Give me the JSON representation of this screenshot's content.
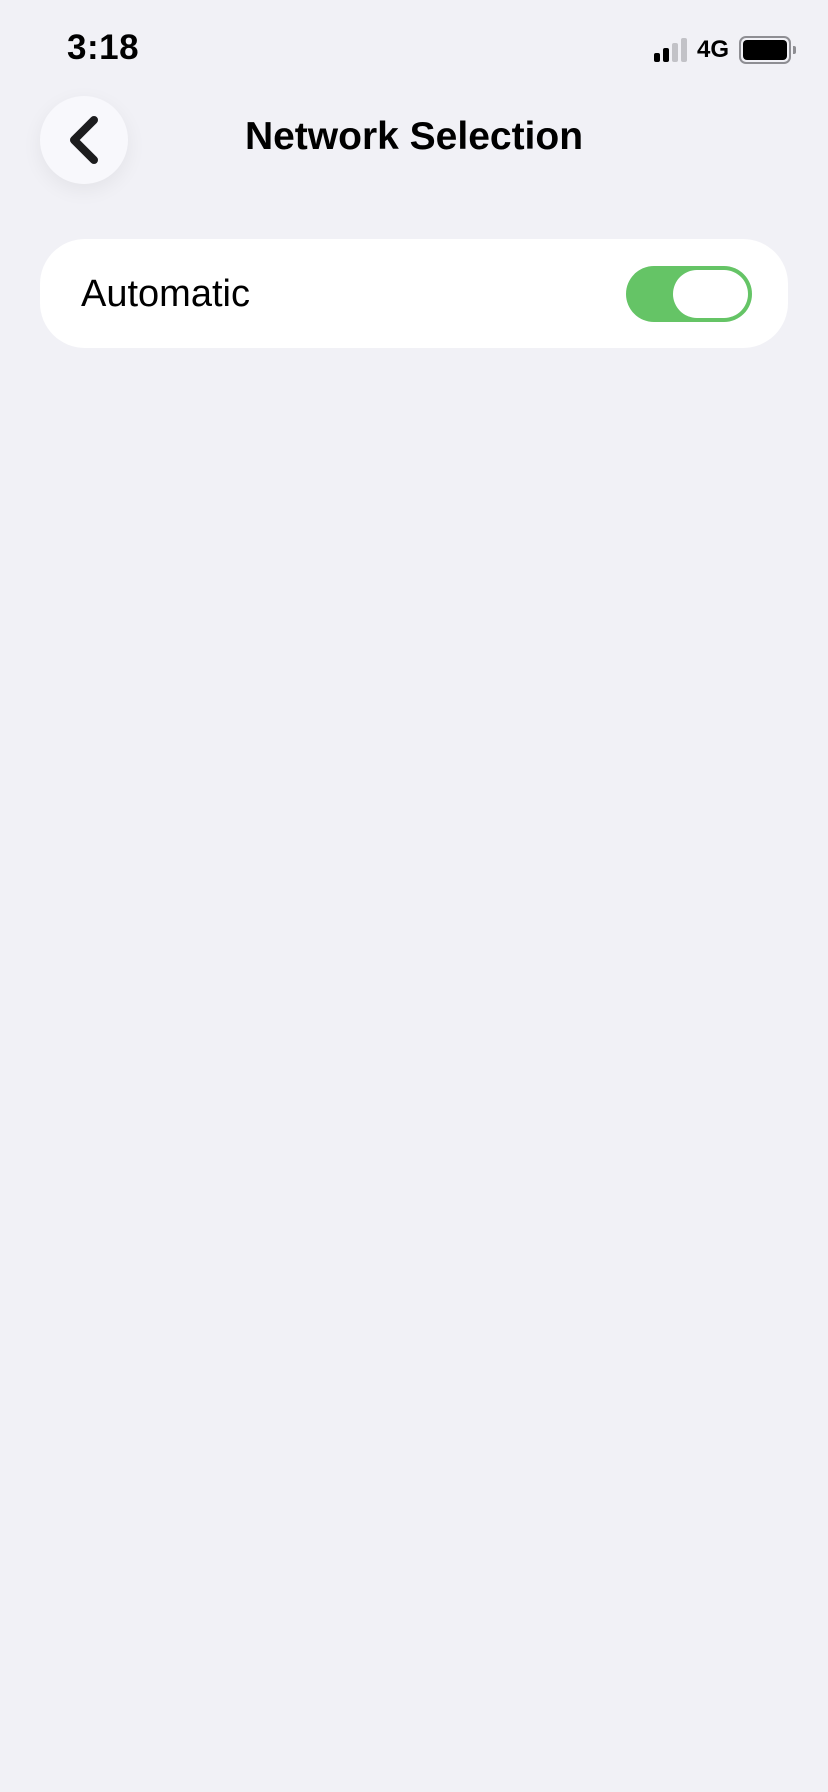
{
  "status_bar": {
    "time": "3:18",
    "network": "4G",
    "signal_bars_active": 2,
    "signal_bars_total": 4,
    "battery_level": 1.0,
    "signal_icon": "cellular-signal-icon",
    "battery_icon": "battery-icon"
  },
  "header": {
    "back_icon": "chevron-left-icon",
    "title": "Network Selection"
  },
  "settings": {
    "automatic": {
      "label": "Automatic",
      "enabled": true
    }
  },
  "colors": {
    "background": "#f1f1f6",
    "card": "#ffffff",
    "toggle_on": "#65c466",
    "signal_active": "#000000",
    "signal_inactive": "#c2c2c7"
  }
}
